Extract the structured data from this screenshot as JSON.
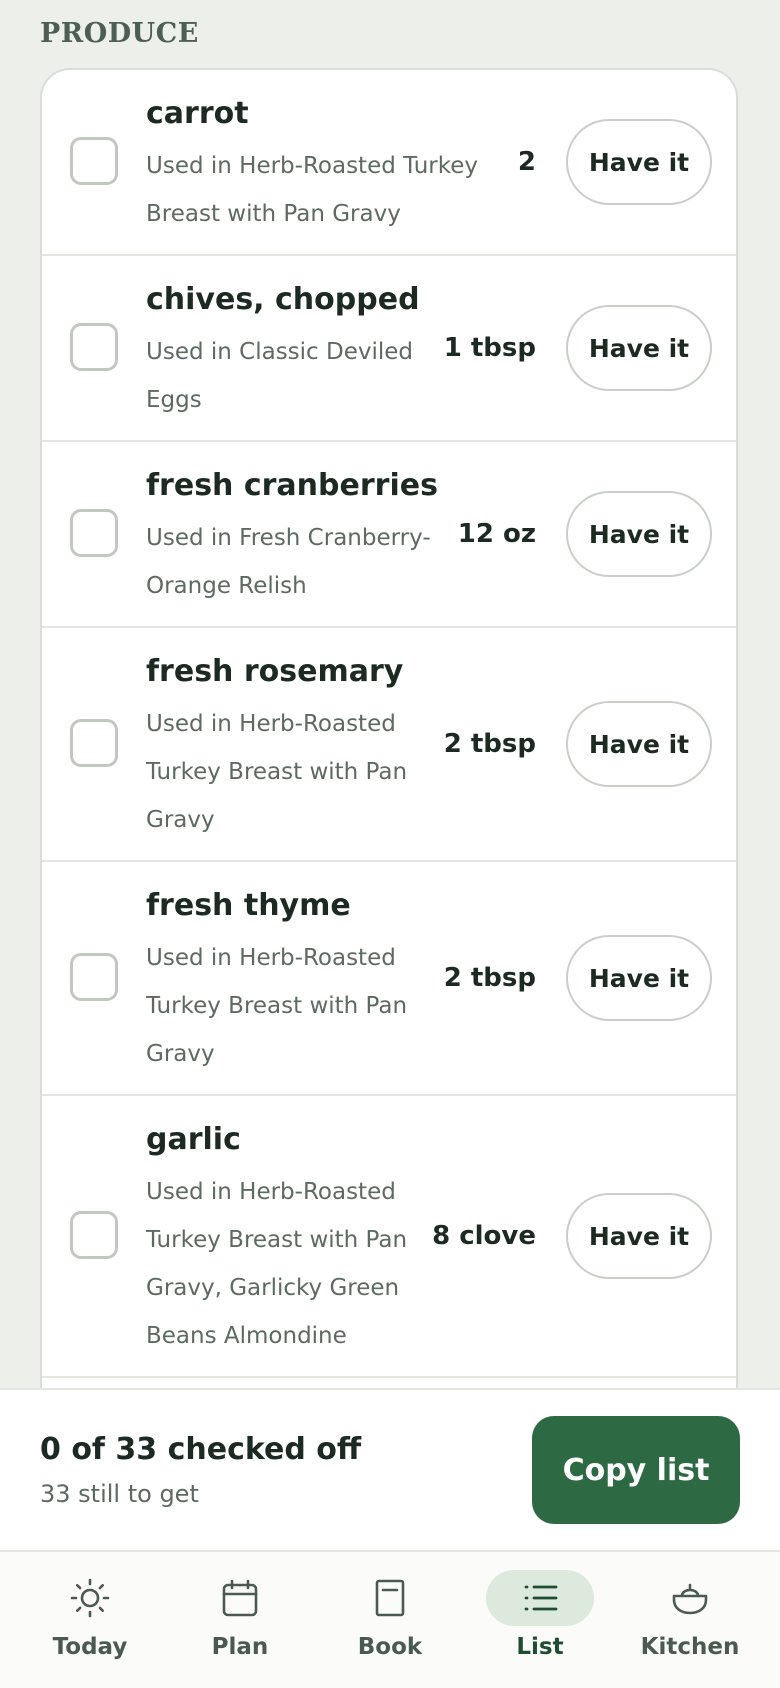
{
  "section": {
    "title": "PRODUCE"
  },
  "items": [
    {
      "name": "carrot",
      "sub_lines": [
        "Used in Herb-Roasted Turkey",
        "Breast with Pan Gravy"
      ],
      "qty": "2",
      "button": "Have it"
    },
    {
      "name": "chives, chopped",
      "sub_lines": [
        "Used in Classic Deviled",
        "Eggs"
      ],
      "qty": "1 tbsp",
      "button": "Have it"
    },
    {
      "name": "fresh cranberries",
      "sub_lines": [
        "Used in Fresh Cranberry-",
        "Orange Relish"
      ],
      "qty": "12 oz",
      "button": "Have it"
    },
    {
      "name": "fresh rosemary",
      "sub_lines": [
        "Used in Herb-Roasted",
        "Turkey Breast with Pan",
        "Gravy"
      ],
      "qty": "2 tbsp",
      "button": "Have it"
    },
    {
      "name": "fresh thyme",
      "sub_lines": [
        "Used in Herb-Roasted",
        "Turkey Breast with Pan",
        "Gravy"
      ],
      "qty": "2 tbsp",
      "button": "Have it"
    },
    {
      "name": "garlic",
      "sub_lines": [
        "Used in Herb-Roasted",
        "Turkey Breast with Pan",
        "Gravy, Garlicky Green",
        "Beans Almondine"
      ],
      "qty": "8 clove",
      "button": "Have it"
    }
  ],
  "footer": {
    "title": "0 of 33 checked off",
    "subtitle": "33 still to get",
    "copy_label": "Copy list"
  },
  "nav": [
    {
      "label": "Today",
      "icon": "sun-icon",
      "active": false
    },
    {
      "label": "Plan",
      "icon": "calendar-icon",
      "active": false
    },
    {
      "label": "Book",
      "icon": "book-icon",
      "active": false
    },
    {
      "label": "List",
      "icon": "list-icon",
      "active": true
    },
    {
      "label": "Kitchen",
      "icon": "pot-icon",
      "active": false
    }
  ],
  "colors": {
    "accent": "#2d6a44",
    "background": "#edf0ea",
    "nav_active": "#dde9dc"
  }
}
